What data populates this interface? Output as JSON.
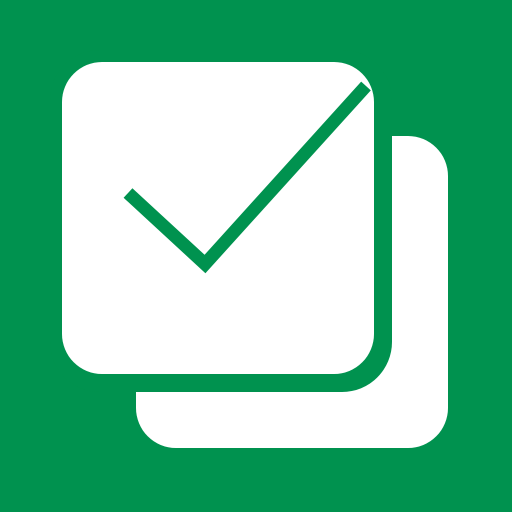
{
  "icon": {
    "name": "multi-select-checkbox-app-icon",
    "colors": {
      "background": "#00924F",
      "card": "#FFFFFF",
      "check": "#00924F"
    }
  }
}
